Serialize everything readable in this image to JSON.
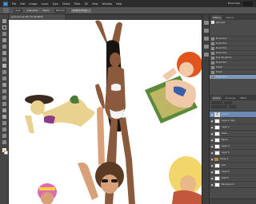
{
  "menubar": {
    "logo": "Ps",
    "items": [
      "File",
      "Edit",
      "Image",
      "Layer",
      "Type",
      "Select",
      "Filter",
      "3D",
      "View",
      "Window",
      "Help"
    ],
    "workspace": "Essentials"
  },
  "options": {
    "size_field": "4 px",
    "antialias_label": "Anti-alias",
    "style_label": "Style:",
    "style_value": "Normal",
    "refine_label": "Refine Edge..."
  },
  "document": {
    "tab_title": "girls.psd @ 66.7% (RGB/8)"
  },
  "panel": {
    "tabs": [
      "History",
      "Actions"
    ],
    "history_title": "girls.psd",
    "history_items": [
      "Brush Tool",
      "Brush Tool",
      "Brush Tool",
      "Brush Tool",
      "Free Transform",
      "Brush Tool",
      "Eraser",
      "Eraser",
      "Brush Tool"
    ],
    "layer_tabs": [
      "Layers",
      "Channels",
      "Paths"
    ],
    "layers": [
      "Layer 1",
      "Layer 2 copy",
      "Layer 3",
      "dress",
      "figure",
      "Layer 4",
      "Layer 5",
      "Group 1",
      "skin",
      "Layer 6",
      "sketch",
      "Background"
    ]
  },
  "colors": {
    "accent": "#1e6fb8",
    "selection": "#6b8ab5",
    "foreground": "#f7e85c",
    "background": "#ffffff"
  }
}
